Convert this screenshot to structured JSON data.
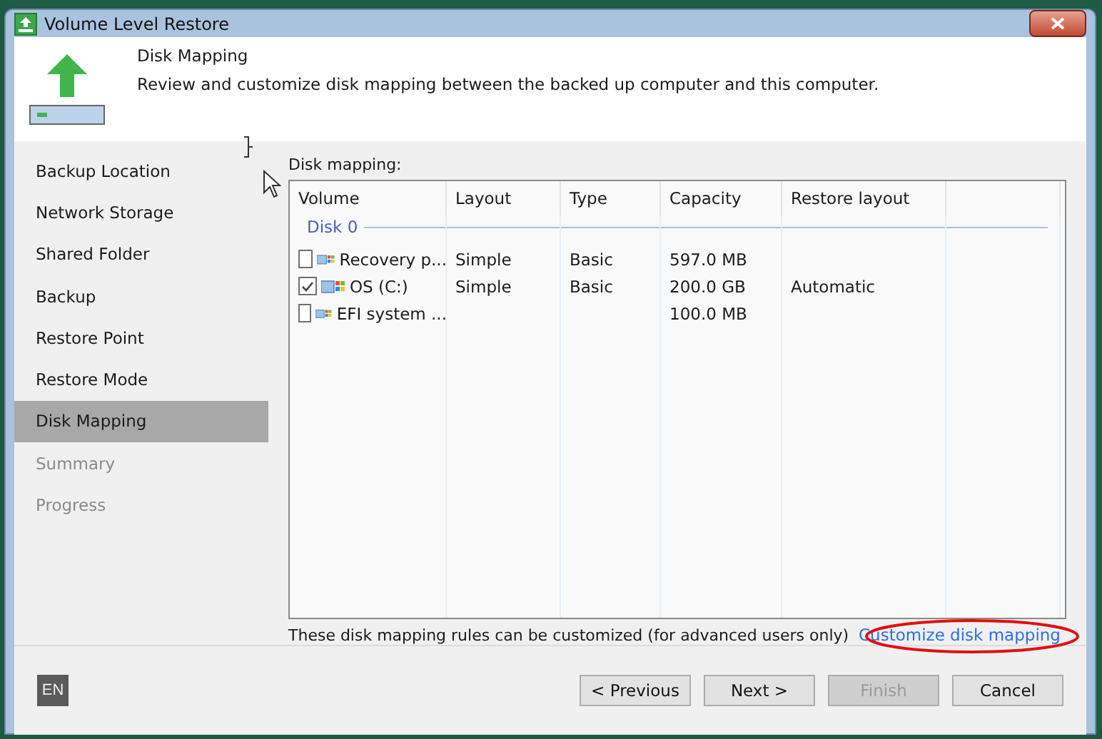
{
  "window": {
    "title": "Volume Level Restore"
  },
  "header": {
    "title": "Disk Mapping",
    "description": "Review and customize disk mapping between the backed up computer and this computer."
  },
  "steps": [
    {
      "label": "Backup Location",
      "selected": false,
      "disabled": false
    },
    {
      "label": "Network Storage",
      "selected": false,
      "disabled": false
    },
    {
      "label": "Shared Folder",
      "selected": false,
      "disabled": false
    },
    {
      "label": "Backup",
      "selected": false,
      "disabled": false
    },
    {
      "label": "Restore Point",
      "selected": false,
      "disabled": false
    },
    {
      "label": "Restore Mode",
      "selected": false,
      "disabled": false
    },
    {
      "label": "Disk Mapping",
      "selected": true,
      "disabled": false
    },
    {
      "label": "Summary",
      "selected": false,
      "disabled": true
    },
    {
      "label": "Progress",
      "selected": false,
      "disabled": true
    }
  ],
  "table": {
    "label": "Disk mapping:",
    "columns": [
      "Volume",
      "Layout",
      "Type",
      "Capacity",
      "Restore layout"
    ],
    "group": "Disk 0",
    "rows": [
      {
        "checked": false,
        "cells": [
          "Recovery p...",
          "Simple",
          "Basic",
          "597.0 MB",
          ""
        ]
      },
      {
        "checked": true,
        "cells": [
          "OS (C:)",
          "Simple",
          "Basic",
          "200.0 GB",
          "Automatic"
        ]
      },
      {
        "checked": false,
        "cells": [
          "EFI system ...",
          "",
          "",
          "100.0 MB",
          ""
        ]
      }
    ]
  },
  "note": "These disk mapping rules can be customized (for advanced users only)",
  "link": "Customize disk mapping",
  "language": "EN",
  "buttons": [
    {
      "label": "< Previous",
      "disabled": false
    },
    {
      "label": "Next >",
      "disabled": false
    },
    {
      "label": "Finish",
      "disabled": true
    },
    {
      "label": "Cancel",
      "disabled": false
    }
  ]
}
